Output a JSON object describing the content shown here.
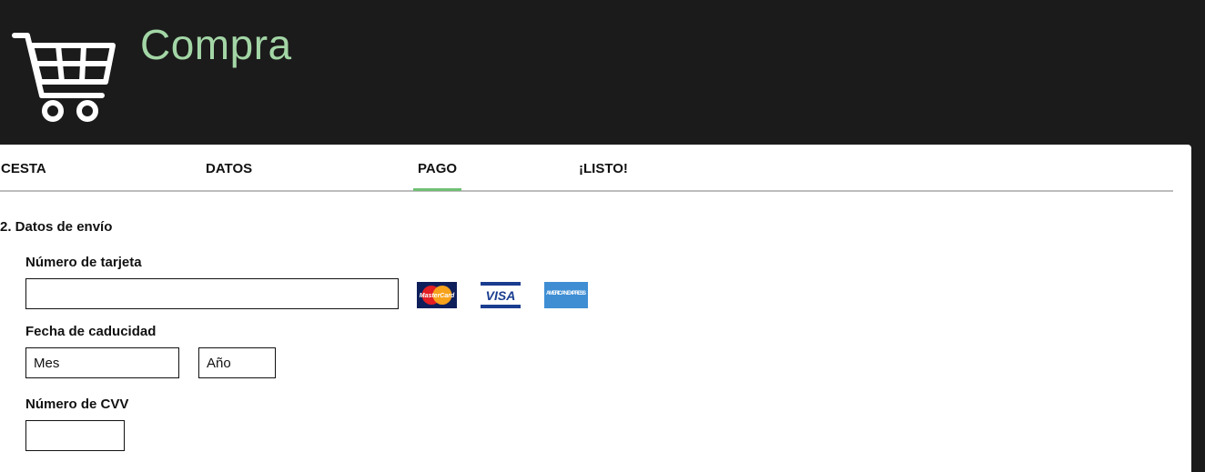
{
  "header": {
    "brand": "Compra",
    "brand_color": "#a3d6a6",
    "icon": "shopping-cart-icon"
  },
  "steps": [
    {
      "label": "CESTA",
      "active": false
    },
    {
      "label": "DATOS",
      "active": false
    },
    {
      "label": "PAGO",
      "active": true
    },
    {
      "label": "¡LISTO!",
      "active": false
    }
  ],
  "accent_color": "#6fbf73",
  "form": {
    "section_title": "2. Datos de envío",
    "card_number": {
      "label": "Número de tarjeta",
      "value": ""
    },
    "expiry": {
      "label": "Fecha de caducidad",
      "month_value": "Mes",
      "year_value": "Año"
    },
    "cvv": {
      "label": "Número de CVV",
      "value": ""
    },
    "card_brands": [
      {
        "name": "mastercard-icon",
        "text": "MasterCard"
      },
      {
        "name": "visa-icon",
        "text": "VISA"
      },
      {
        "name": "amex-icon",
        "text": "AMERICAN EXPRESS"
      }
    ]
  }
}
